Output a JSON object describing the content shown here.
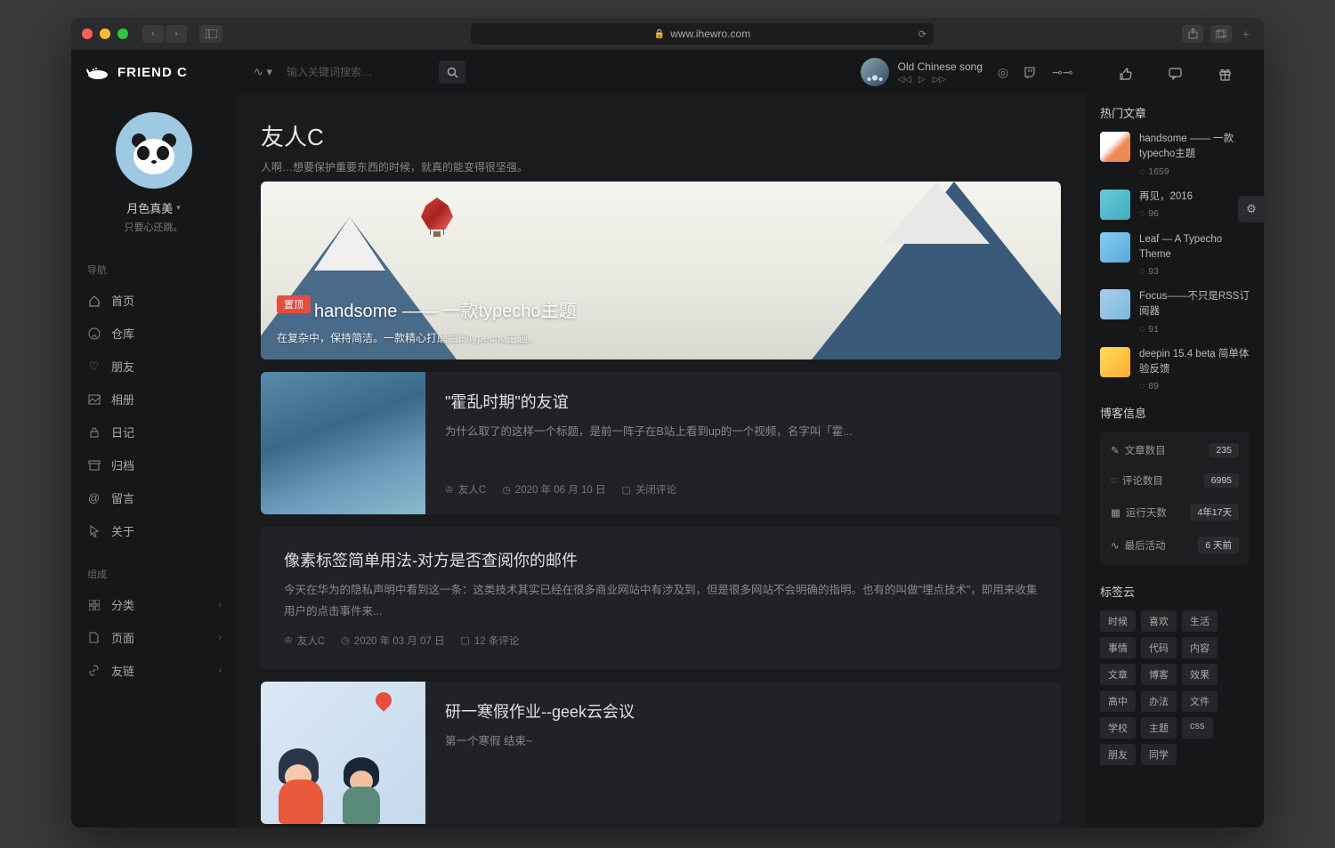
{
  "browser": {
    "url": "www.ihewro.com"
  },
  "brand": "FRIEND C",
  "profile": {
    "name": "月色真美",
    "sub": "只要心还跳。"
  },
  "nav": {
    "section1": "导航",
    "items1": [
      {
        "label": "首页"
      },
      {
        "label": "仓库"
      },
      {
        "label": "朋友"
      },
      {
        "label": "相册"
      },
      {
        "label": "日记"
      },
      {
        "label": "归档"
      },
      {
        "label": "留言"
      },
      {
        "label": "关于"
      }
    ],
    "section2": "组成",
    "items2": [
      {
        "label": "分类"
      },
      {
        "label": "页面"
      },
      {
        "label": "友链"
      }
    ]
  },
  "search": {
    "placeholder": "输入关键词搜索…"
  },
  "nowplaying": {
    "title": "Old Chinese song"
  },
  "page": {
    "title": "友人C",
    "sub": "人啊…想要保护重要东西的时候，就真的能变得很坚强。"
  },
  "hero": {
    "pin": "置顶",
    "title": "handsome —— 一款typecho主题",
    "sub": "在复杂中，保持简洁。一款精心打磨后的typecho主题。"
  },
  "posts": [
    {
      "title": "\"霍乱时期\"的友谊",
      "excerpt": "为什么取了的这样一个标题，是前一阵子在B站上看到up的一个视频，名字叫「霍...",
      "author": "友人C",
      "date": "2020 年 06 月 10 日",
      "comments": "关闭评论"
    },
    {
      "title": "像素标签简单用法-对方是否查阅你的邮件",
      "excerpt": "今天在华为的隐私声明中看到这一条：这类技术其实已经在很多商业网站中有涉及到，但是很多网站不会明确的指明。也有的叫做\"埋点技术\"，即用来收集用户的点击事件来...",
      "author": "友人C",
      "date": "2020 年 03 月 07 日",
      "comments": "12 条评论"
    },
    {
      "title": "研一寒假作业--geek云会议",
      "excerpt": "第一个寒假 结束~"
    }
  ],
  "hot": {
    "title": "热门文章",
    "items": [
      {
        "title": "handsome —— 一款typecho主题",
        "count": "1659"
      },
      {
        "title": "再见，2016",
        "count": "96"
      },
      {
        "title": "Leaf — A Typecho Theme",
        "count": "93"
      },
      {
        "title": "Focus——不只是RSS订阅器",
        "count": "91"
      },
      {
        "title": "deepin 15.4 beta 简单体验反馈",
        "count": "89"
      }
    ]
  },
  "bloginfo": {
    "title": "博客信息",
    "rows": [
      {
        "label": "文章数目",
        "val": "235"
      },
      {
        "label": "评论数目",
        "val": "6995"
      },
      {
        "label": "运行天数",
        "val": "4年17天"
      },
      {
        "label": "最后活动",
        "val": "6 天前"
      }
    ]
  },
  "tagcloud": {
    "title": "标签云",
    "tags": [
      "时候",
      "喜欢",
      "生活",
      "事情",
      "代码",
      "内容",
      "文章",
      "博客",
      "效果",
      "高中",
      "办法",
      "文件",
      "学校",
      "主题",
      "css",
      "朋友",
      "同学"
    ]
  }
}
